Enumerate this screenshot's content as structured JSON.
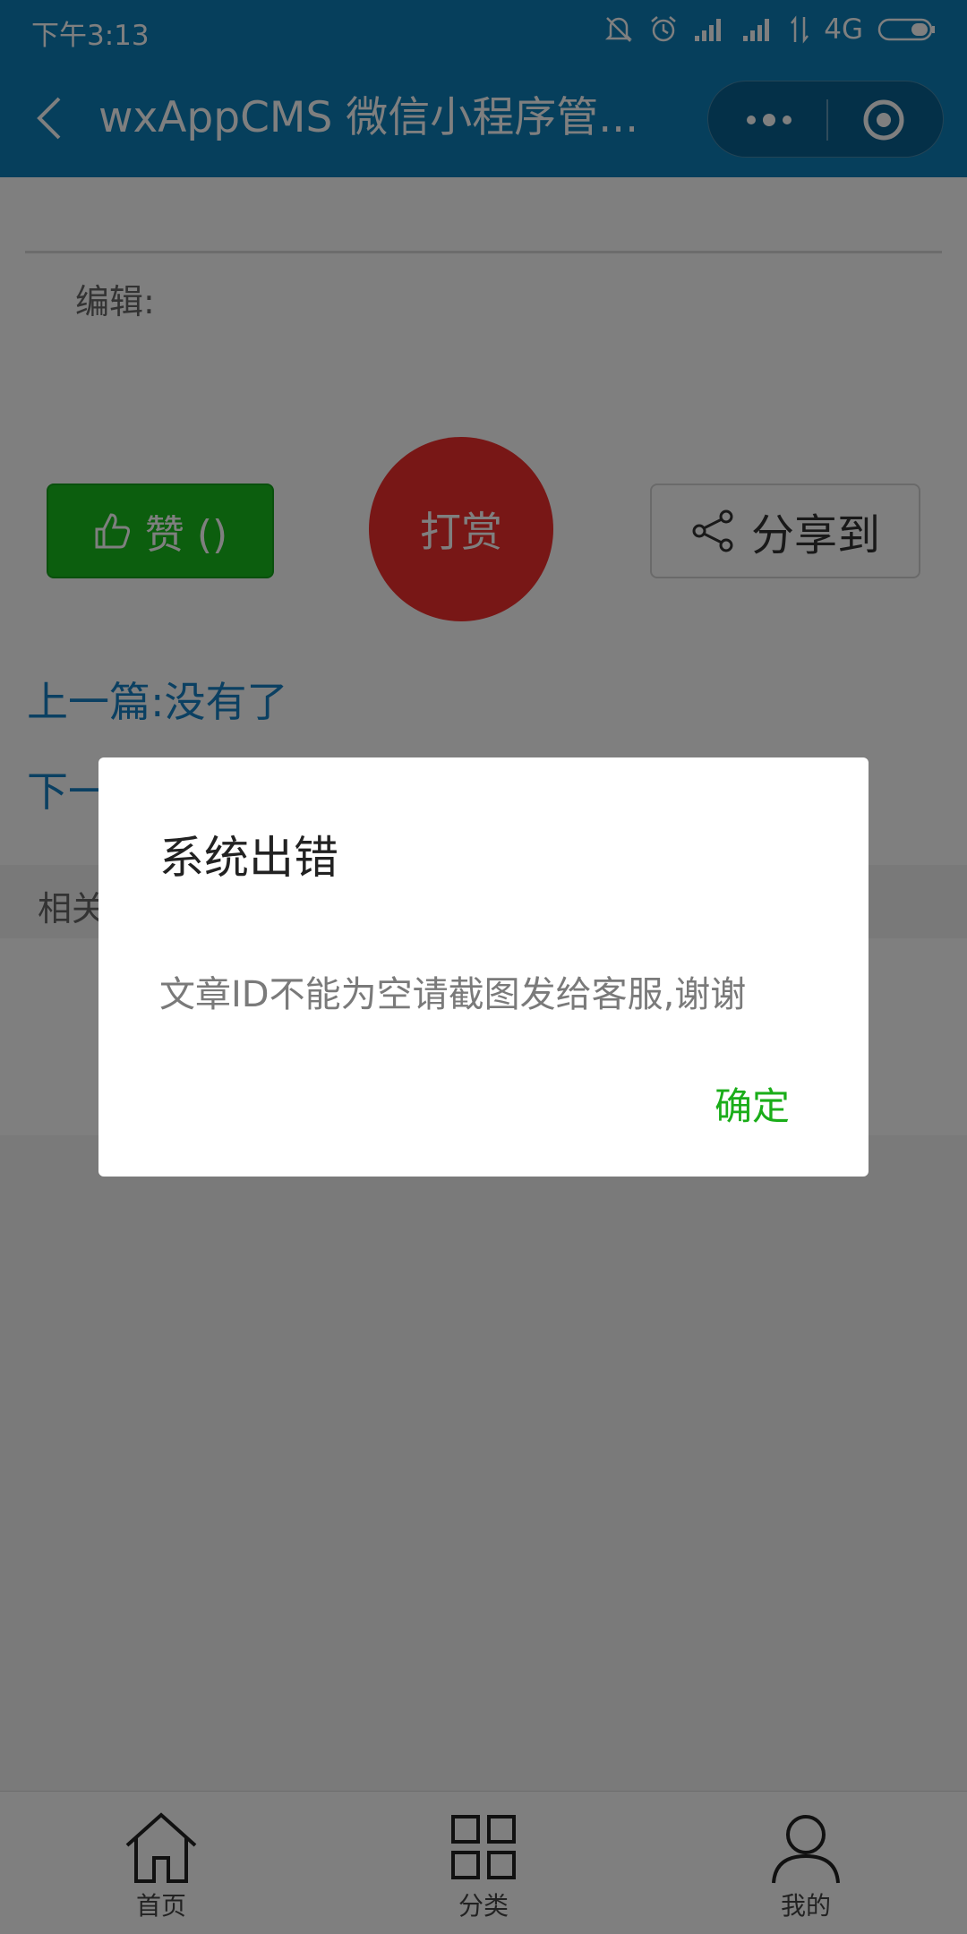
{
  "status_bar": {
    "time": "下午3:13",
    "network": "4G"
  },
  "nav": {
    "title": "wxAppCMS 微信小程序管..."
  },
  "article": {
    "editor_label": "编辑:"
  },
  "actions": {
    "like_label": "赞 ()",
    "reward_label": "打赏",
    "share_label": "分享到"
  },
  "links": {
    "prev": "上一篇:没有了",
    "next_partial": "下一"
  },
  "related": {
    "label_partial": "相关"
  },
  "dialog": {
    "title": "系统出错",
    "message": "文章ID不能为空请截图发给客服,谢谢",
    "confirm": "确定"
  },
  "tabbar": {
    "items": [
      {
        "label": "首页",
        "icon": "home-icon"
      },
      {
        "label": "分类",
        "icon": "grid-icon"
      },
      {
        "label": "我的",
        "icon": "user-icon"
      }
    ]
  },
  "colors": {
    "nav_bg": "#0d7fb8",
    "like_green": "#19bd1d",
    "reward_red": "#f12e2d",
    "link_blue": "#1680c4",
    "confirm_green": "#1aad19"
  }
}
